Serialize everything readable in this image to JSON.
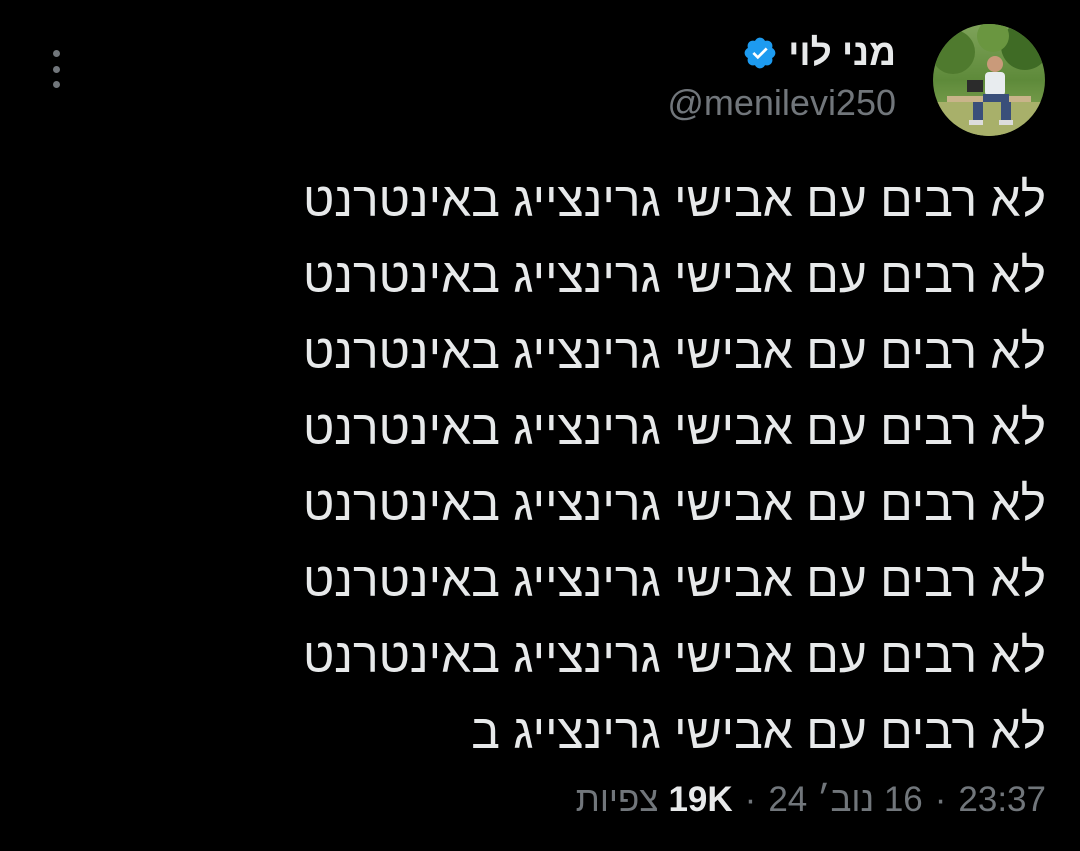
{
  "author": {
    "display_name": "מני לוי",
    "handle": "@menilevi250",
    "verified": true,
    "verified_color": "#1d9bf0",
    "avatar": "profile-photo"
  },
  "tweet": {
    "lines": [
      "לא רבים עם אבישי גרינצייג באינטרנט",
      "לא רבים עם אבישי גרינצייג באינטרנט",
      "לא רבים עם אבישי גרינצייג באינטרנט",
      "לא רבים עם אבישי גרינצייג באינטרנט",
      "לא רבים עם אבישי גרינצייג באינטרנט",
      "לא רבים עם אבישי גרינצייג באינטרנט",
      "לא רבים עם אבישי גרינצייג באינטרנט",
      "לא רבים עם אבישי גרינצייג ב"
    ]
  },
  "meta": {
    "time": "23:37",
    "date": "16 נוב׳ 24",
    "separator": "·",
    "views_count": "19K",
    "views_label": "צפיות"
  },
  "icons": {
    "more": "more-vertical-icon",
    "verified": "verified-badge-icon"
  },
  "colors": {
    "background": "#000000",
    "text_primary": "#e7e9ea",
    "text_secondary": "#71767b"
  }
}
